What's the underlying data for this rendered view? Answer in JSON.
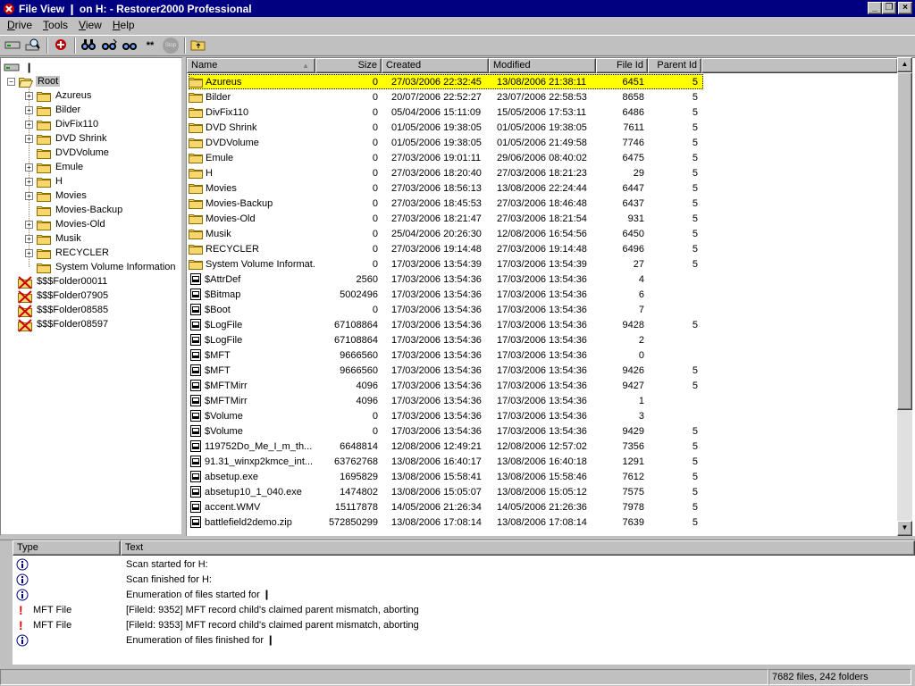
{
  "window": {
    "title": "File View ❙ on H: - Restorer2000 Professional",
    "controls": [
      "_",
      "❐",
      "×"
    ]
  },
  "menu": [
    {
      "label": "Drive",
      "mnemonic": "D"
    },
    {
      "label": "Tools",
      "mnemonic": "T"
    },
    {
      "label": "View",
      "mnemonic": "V"
    },
    {
      "label": "Help",
      "mnemonic": "H"
    }
  ],
  "toolbar": {
    "buttons": [
      "drive-icon",
      "scan-icon",
      "restore-icon",
      "find-icon",
      "find-next-icon",
      "find-mask-icon",
      "stop-icon",
      "folder-up-icon"
    ],
    "stop_label": "Stop",
    "mask_label": "**"
  },
  "tree": {
    "drive_label": "❙",
    "root_label": "Root",
    "items": [
      {
        "label": "Azureus",
        "expandable": true
      },
      {
        "label": "Bilder",
        "expandable": true
      },
      {
        "label": "DivFix110",
        "expandable": true
      },
      {
        "label": "DVD Shrink",
        "expandable": true
      },
      {
        "label": "DVDVolume",
        "expandable": false
      },
      {
        "label": "Emule",
        "expandable": true
      },
      {
        "label": "H",
        "expandable": true
      },
      {
        "label": "Movies",
        "expandable": true
      },
      {
        "label": "Movies-Backup",
        "expandable": false
      },
      {
        "label": "Movies-Old",
        "expandable": true
      },
      {
        "label": "Musik",
        "expandable": true
      },
      {
        "label": "RECYCLER",
        "expandable": true
      },
      {
        "label": "System Volume Information",
        "expandable": false
      }
    ],
    "lost_folders": [
      "$$$Folder00011",
      "$$$Folder07905",
      "$$$Folder08585",
      "$$$Folder08597"
    ]
  },
  "list": {
    "columns": [
      "Name",
      "Size",
      "Created",
      "Modified",
      "File Id",
      "Parent Id"
    ],
    "rows": [
      {
        "name": "Azureus",
        "type": "folder",
        "size": "0",
        "created": "27/03/2006 22:32:45",
        "modified": "13/08/2006 21:38:11",
        "fid": "6451",
        "pid": "5",
        "selected": true
      },
      {
        "name": "Bilder",
        "type": "folder",
        "size": "0",
        "created": "20/07/2006 22:52:27",
        "modified": "23/07/2006 22:58:53",
        "fid": "8658",
        "pid": "5"
      },
      {
        "name": "DivFix110",
        "type": "folder",
        "size": "0",
        "created": "05/04/2006 15:11:09",
        "modified": "15/05/2006 17:53:11",
        "fid": "6486",
        "pid": "5"
      },
      {
        "name": "DVD Shrink",
        "type": "folder",
        "size": "0",
        "created": "01/05/2006 19:38:05",
        "modified": "01/05/2006 19:38:05",
        "fid": "7611",
        "pid": "5"
      },
      {
        "name": "DVDVolume",
        "type": "folder",
        "size": "0",
        "created": "01/05/2006 19:38:05",
        "modified": "01/05/2006 21:49:58",
        "fid": "7746",
        "pid": "5"
      },
      {
        "name": "Emule",
        "type": "folder",
        "size": "0",
        "created": "27/03/2006 19:01:11",
        "modified": "29/06/2006 08:40:02",
        "fid": "6475",
        "pid": "5"
      },
      {
        "name": "H",
        "type": "folder",
        "size": "0",
        "created": "27/03/2006 18:20:40",
        "modified": "27/03/2006 18:21:23",
        "fid": "29",
        "pid": "5"
      },
      {
        "name": "Movies",
        "type": "folder",
        "size": "0",
        "created": "27/03/2006 18:56:13",
        "modified": "13/08/2006 22:24:44",
        "fid": "6447",
        "pid": "5"
      },
      {
        "name": "Movies-Backup",
        "type": "folder",
        "size": "0",
        "created": "27/03/2006 18:45:53",
        "modified": "27/03/2006 18:46:48",
        "fid": "6437",
        "pid": "5"
      },
      {
        "name": "Movies-Old",
        "type": "folder",
        "size": "0",
        "created": "27/03/2006 18:21:47",
        "modified": "27/03/2006 18:21:54",
        "fid": "931",
        "pid": "5"
      },
      {
        "name": "Musik",
        "type": "folder",
        "size": "0",
        "created": "25/04/2006 20:26:30",
        "modified": "12/08/2006 16:54:56",
        "fid": "6450",
        "pid": "5"
      },
      {
        "name": "RECYCLER",
        "type": "folder",
        "size": "0",
        "created": "27/03/2006 19:14:48",
        "modified": "27/03/2006 19:14:48",
        "fid": "6496",
        "pid": "5"
      },
      {
        "name": "System Volume Informat...",
        "type": "folder",
        "size": "0",
        "created": "17/03/2006 13:54:39",
        "modified": "17/03/2006 13:54:39",
        "fid": "27",
        "pid": "5"
      },
      {
        "name": "$AttrDef",
        "type": "file",
        "size": "2560",
        "created": "17/03/2006 13:54:36",
        "modified": "17/03/2006 13:54:36",
        "fid": "4",
        "pid": ""
      },
      {
        "name": "$Bitmap",
        "type": "file",
        "size": "5002496",
        "created": "17/03/2006 13:54:36",
        "modified": "17/03/2006 13:54:36",
        "fid": "6",
        "pid": ""
      },
      {
        "name": "$Boot",
        "type": "file",
        "size": "0",
        "created": "17/03/2006 13:54:36",
        "modified": "17/03/2006 13:54:36",
        "fid": "7",
        "pid": ""
      },
      {
        "name": "$LogFile",
        "type": "file",
        "size": "67108864",
        "created": "17/03/2006 13:54:36",
        "modified": "17/03/2006 13:54:36",
        "fid": "9428",
        "pid": "5"
      },
      {
        "name": "$LogFile",
        "type": "file",
        "size": "67108864",
        "created": "17/03/2006 13:54:36",
        "modified": "17/03/2006 13:54:36",
        "fid": "2",
        "pid": ""
      },
      {
        "name": "$MFT",
        "type": "file",
        "size": "9666560",
        "created": "17/03/2006 13:54:36",
        "modified": "17/03/2006 13:54:36",
        "fid": "0",
        "pid": ""
      },
      {
        "name": "$MFT",
        "type": "file",
        "size": "9666560",
        "created": "17/03/2006 13:54:36",
        "modified": "17/03/2006 13:54:36",
        "fid": "9426",
        "pid": "5"
      },
      {
        "name": "$MFTMirr",
        "type": "file",
        "size": "4096",
        "created": "17/03/2006 13:54:36",
        "modified": "17/03/2006 13:54:36",
        "fid": "9427",
        "pid": "5"
      },
      {
        "name": "$MFTMirr",
        "type": "file",
        "size": "4096",
        "created": "17/03/2006 13:54:36",
        "modified": "17/03/2006 13:54:36",
        "fid": "1",
        "pid": ""
      },
      {
        "name": "$Volume",
        "type": "file",
        "size": "0",
        "created": "17/03/2006 13:54:36",
        "modified": "17/03/2006 13:54:36",
        "fid": "3",
        "pid": ""
      },
      {
        "name": "$Volume",
        "type": "file",
        "size": "0",
        "created": "17/03/2006 13:54:36",
        "modified": "17/03/2006 13:54:36",
        "fid": "9429",
        "pid": "5"
      },
      {
        "name": "119752Do_Me_I_m_th...",
        "type": "file",
        "size": "6648814",
        "created": "12/08/2006 12:49:21",
        "modified": "12/08/2006 12:57:02",
        "fid": "7356",
        "pid": "5"
      },
      {
        "name": "91.31_winxp2kmce_int...",
        "type": "file",
        "size": "63762768",
        "created": "13/08/2006 16:40:17",
        "modified": "13/08/2006 16:40:18",
        "fid": "1291",
        "pid": "5"
      },
      {
        "name": "absetup.exe",
        "type": "file",
        "size": "1695829",
        "created": "13/08/2006 15:58:41",
        "modified": "13/08/2006 15:58:46",
        "fid": "7612",
        "pid": "5"
      },
      {
        "name": "absetup10_1_040.exe",
        "type": "file",
        "size": "1474802",
        "created": "13/08/2006 15:05:07",
        "modified": "13/08/2006 15:05:12",
        "fid": "7575",
        "pid": "5"
      },
      {
        "name": "accent.WMV",
        "type": "file",
        "size": "15117878",
        "created": "14/05/2006 21:26:34",
        "modified": "14/05/2006 21:26:36",
        "fid": "7978",
        "pid": "5"
      },
      {
        "name": "battlefield2demo.zip",
        "type": "file",
        "size": "572850299",
        "created": "13/08/2006 17:08:14",
        "modified": "13/08/2006 17:08:14",
        "fid": "7639",
        "pid": "5"
      }
    ]
  },
  "log": {
    "columns": [
      "Type",
      "Text"
    ],
    "rows": [
      {
        "kind": "info",
        "type": "",
        "text": "Scan started for H:"
      },
      {
        "kind": "info",
        "type": "",
        "text": "Scan finished for H:"
      },
      {
        "kind": "info",
        "type": "",
        "text": "Enumeration of files started for ❙"
      },
      {
        "kind": "error",
        "type": "MFT File",
        "text": "[FileId: 9352] MFT record child's claimed parent mismatch, aborting"
      },
      {
        "kind": "error",
        "type": "MFT File",
        "text": "[FileId: 9353] MFT record child's claimed parent mismatch, aborting"
      },
      {
        "kind": "info",
        "type": "",
        "text": "Enumeration of files finished for ❙"
      }
    ]
  },
  "status": {
    "counts": "7682 files, 242 folders"
  },
  "colors": {
    "title_bg": "#000080",
    "selection": "#ffff00",
    "error": "#e00000"
  }
}
